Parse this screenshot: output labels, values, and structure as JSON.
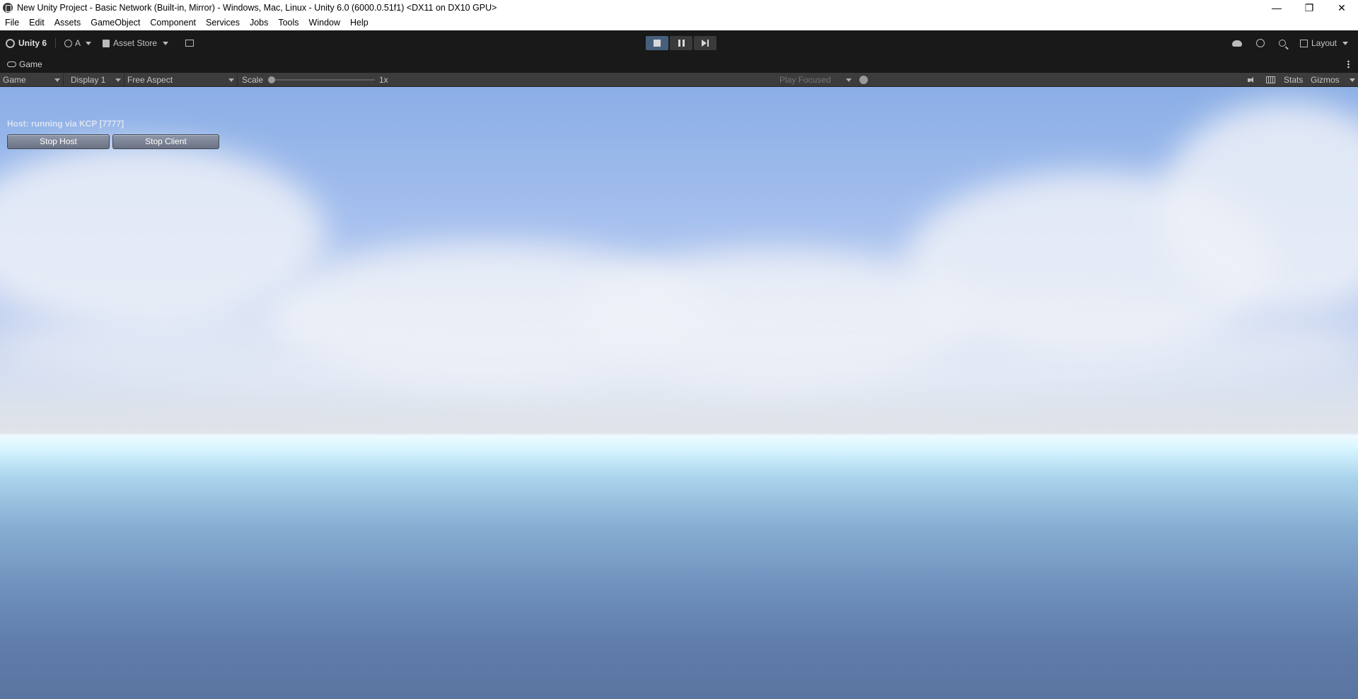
{
  "window": {
    "title": "New Unity Project - Basic Network (Built-in, Mirror) - Windows, Mac, Linux - Unity 6.0 (6000.0.51f1) <DX11 on DX10 GPU>",
    "controls": {
      "minimize": "—",
      "restore": "❐",
      "close": "✕"
    }
  },
  "menu": [
    "File",
    "Edit",
    "Assets",
    "GameObject",
    "Component",
    "Services",
    "Jobs",
    "Tools",
    "Window",
    "Help"
  ],
  "toolbar": {
    "unity_label": "Unity 6",
    "account_label": "A",
    "asset_store_label": "Asset Store",
    "layout_label": "Layout",
    "play_state": "playing"
  },
  "tab": {
    "label": "Game"
  },
  "gamebar": {
    "mode": "Game",
    "display": "Display 1",
    "aspect": "Free Aspect",
    "scale_label": "Scale",
    "scale_value": "1x",
    "play_focus": "Play Focused",
    "stats_label": "Stats",
    "gizmos_label": "Gizmos"
  },
  "game": {
    "status_text": "Host: running via KCP [7777]",
    "stop_host_label": "Stop Host",
    "stop_client_label": "Stop Client"
  },
  "colors": {
    "editor_bg": "#191919",
    "toolbar_bg": "#3c3c3c",
    "play_active": "#46607c",
    "sky_top": "#8aaee6",
    "horizon": "#eefaff",
    "ground_bottom": "#5a74a0"
  }
}
